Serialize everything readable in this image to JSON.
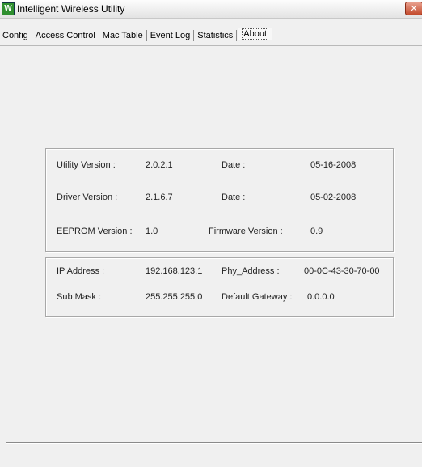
{
  "window": {
    "title": "Intelligent Wireless Utility",
    "icon": "app-icon",
    "close_glyph": "✕"
  },
  "tabs": [
    {
      "label": "Config",
      "active": false
    },
    {
      "label": "Access Control",
      "active": false
    },
    {
      "label": "Mac Table",
      "active": false
    },
    {
      "label": "Event Log",
      "active": false
    },
    {
      "label": "Statistics",
      "active": false
    },
    {
      "label": "About",
      "active": true
    }
  ],
  "versions": {
    "utility_label": "Utility Version :",
    "utility_value": "2.0.2.1",
    "utility_date_label": "Date :",
    "utility_date_value": "05-16-2008",
    "driver_label": "Driver Version :",
    "driver_value": "2.1.6.7",
    "driver_date_label": "Date :",
    "driver_date_value": "05-02-2008",
    "eeprom_label": "EEPROM Version :",
    "eeprom_value": "1.0",
    "firmware_label": "Firmware Version :",
    "firmware_value": "0.9"
  },
  "network": {
    "ip_label": "IP Address :",
    "ip_value": "192.168.123.1",
    "phy_label": "Phy_Address :",
    "phy_value": "00-0C-43-30-70-00",
    "mask_label": "Sub Mask :",
    "mask_value": "255.255.255.0",
    "gateway_label": "Default Gateway :",
    "gateway_value": "0.0.0.0"
  }
}
